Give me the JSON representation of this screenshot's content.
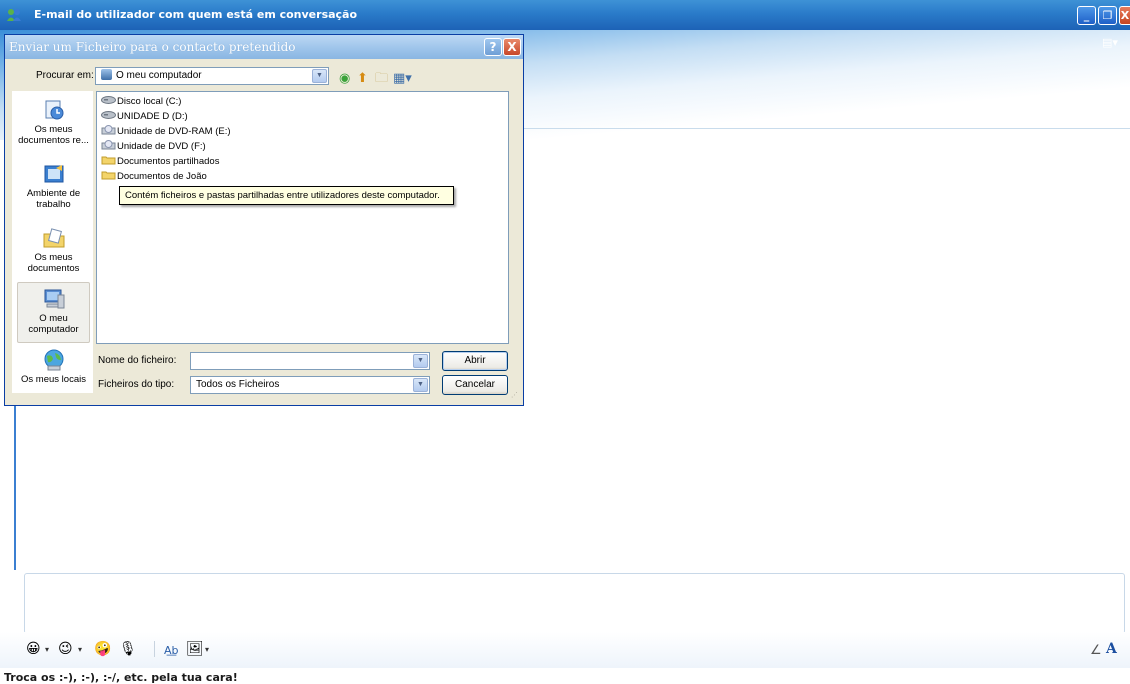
{
  "main_window": {
    "title": "E-mail do utilizador com quem está em conversação",
    "status": "Troca os :-), :-), :-/, etc. pela tua cara!"
  },
  "dialog": {
    "title": "Enviar um Ficheiro para  o contacto pretendido",
    "look_in_label": "Procurar em:",
    "look_in_value": "O meu computador",
    "places": [
      {
        "label": "Os meus documentos re...",
        "icon": "recent-documents-icon"
      },
      {
        "label": "Ambiente de trabalho",
        "icon": "desktop-icon"
      },
      {
        "label": "Os meus documentos",
        "icon": "my-documents-icon"
      },
      {
        "label": "O meu computador",
        "icon": "my-computer-icon",
        "selected": true
      },
      {
        "label": "Os meus locais",
        "icon": "network-places-icon"
      }
    ],
    "files": [
      {
        "name": "Disco local (C:)",
        "icon": "hard-drive-icon"
      },
      {
        "name": "UNIDADE D (D:)",
        "icon": "hard-drive-icon"
      },
      {
        "name": "Unidade de DVD-RAM (E:)",
        "icon": "dvd-drive-icon"
      },
      {
        "name": "Unidade de DVD (F:)",
        "icon": "dvd-drive-icon"
      },
      {
        "name": "Documentos partilhados",
        "icon": "folder-icon"
      },
      {
        "name": "Documentos de João",
        "icon": "folder-icon"
      }
    ],
    "tooltip": "Contém ficheiros e pastas partilhadas entre utilizadores deste computador.",
    "filename_label": "Nome do ficheiro:",
    "filename_value": "",
    "filetype_label": "Ficheiros do tipo:",
    "filetype_value": "Todos os Ficheiros",
    "open_button": "Abrir",
    "cancel_button": "Cancelar"
  },
  "colors": {
    "titlebar_blue": "#2a7bc9",
    "dialog_bg": "#ece9d8",
    "tooltip_bg": "#ffffe1"
  }
}
